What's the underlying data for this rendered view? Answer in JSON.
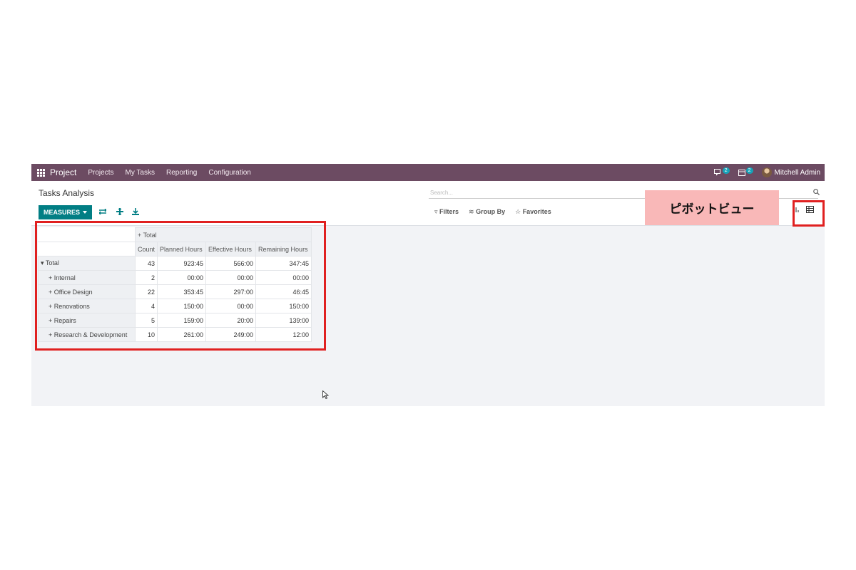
{
  "navbar": {
    "app_name": "Project",
    "menu": [
      "Projects",
      "My Tasks",
      "Reporting",
      "Configuration"
    ],
    "messages_count": "2",
    "activities_count": "2",
    "user_name": "Mitchell Admin"
  },
  "control": {
    "title": "Tasks Analysis",
    "measures_label": "MEASURES",
    "search_placeholder": "Search...",
    "filters_label": "Filters",
    "groupby_label": "Group By",
    "favorites_label": "Favorites"
  },
  "overlay": {
    "callout_text": "ピボットビュー"
  },
  "pivot": {
    "col_group_header": "Total",
    "columns": [
      "Count",
      "Planned Hours",
      "Effective Hours",
      "Remaining Hours"
    ],
    "total_row": {
      "label": "Total",
      "values": [
        "43",
        "923:45",
        "566:00",
        "347:45"
      ]
    },
    "rows": [
      {
        "label": "Internal",
        "values": [
          "2",
          "00:00",
          "00:00",
          "00:00"
        ]
      },
      {
        "label": "Office Design",
        "values": [
          "22",
          "353:45",
          "297:00",
          "46:45"
        ]
      },
      {
        "label": "Renovations",
        "values": [
          "4",
          "150:00",
          "00:00",
          "150:00"
        ]
      },
      {
        "label": "Repairs",
        "values": [
          "5",
          "159:00",
          "20:00",
          "139:00"
        ]
      },
      {
        "label": "Research & Development",
        "values": [
          "10",
          "261:00",
          "249:00",
          "12:00"
        ]
      }
    ]
  },
  "colors": {
    "navbar": "#6c4b62",
    "primary": "#017e84",
    "highlight": "#e02020",
    "callout_bg": "#f9b8b8"
  }
}
